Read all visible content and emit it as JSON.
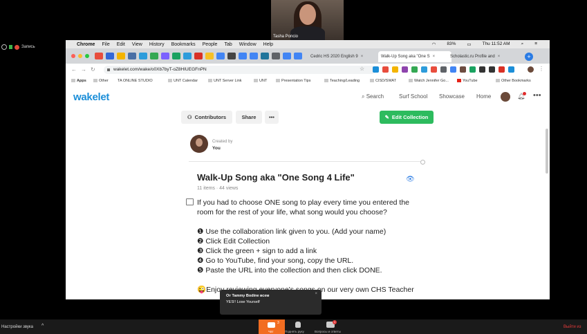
{
  "participant_video": {
    "name": "Tasha Poncio"
  },
  "recording": {
    "label": "Запись"
  },
  "mac_menubar": {
    "items": [
      "Chrome",
      "File",
      "Edit",
      "View",
      "History",
      "Bookmarks",
      "People",
      "Tab",
      "Window",
      "Help"
    ],
    "battery": "83%",
    "clock": "Thu 11:52 AM"
  },
  "browser_tabs": [
    {
      "title": "Cedric HS 2020 English 9"
    },
    {
      "title": "Walk-Up Song aka \"One S"
    },
    {
      "title": "Scholastic.ru Profile and"
    }
  ],
  "address_bar": {
    "url": "wakelet.com/wake/o0Xb7byT-oZ8HIUEGFnPN"
  },
  "bookmarks": [
    "Apps",
    "Other",
    "TA ONLINE STUDIO",
    "UNT Calendar",
    "UNT Server Link",
    "UNT",
    "Presentation Tips",
    "Teaching/Leading",
    "CISD/SWAT",
    "Watch Jennifer Go...",
    "YouTube",
    "Other Bookmarks"
  ],
  "wakelet": {
    "logo": "wakelet",
    "nav": {
      "search": "Search",
      "surf_school": "Surf School",
      "showcase": "Showcase",
      "home": "Home"
    },
    "toolbar": {
      "contributors": "Contributors",
      "share": "Share",
      "more": "•••",
      "edit": "Edit Collection"
    },
    "creator": {
      "created_by": "Created by",
      "name": "You"
    },
    "collection": {
      "title": "Walk-Up Song aka \"One Song 4 Life\"",
      "meta": "11 items · 44 views",
      "description": [
        "If you had to choose ONE song to play every time you entered the room for the rest of your life, what song would you choose?",
        "❶ Use the collaboration link given to you. (Add your name)",
        "❷ Click Edit Collection",
        "❸ Click the green + sign to add a link",
        "❹ Go to YouTube, find your song, copy the URL.",
        "❺ Paste the URL into the collection and then click DONE.",
        "😜Enjoy reviewing everyone's songs on our very own CHS Teacher"
      ]
    }
  },
  "notification": {
    "from": "От Tammy Bodine всем",
    "message": "YES!!  Lose Yourself"
  },
  "zoom_bar": {
    "audio_settings": "Настройки звука",
    "chat": "Чат",
    "chat_badge": "3",
    "raise_hand": "Поднять руку",
    "qa": "Вопросы и ответы",
    "qa_badge": "1",
    "leave": "Выйти из"
  },
  "colors": {
    "wakelet_blue": "#1b8ed8",
    "edit_green": "#2dbb5e",
    "zoom_orange": "#f26d21",
    "leave_red": "#e63b3b"
  }
}
